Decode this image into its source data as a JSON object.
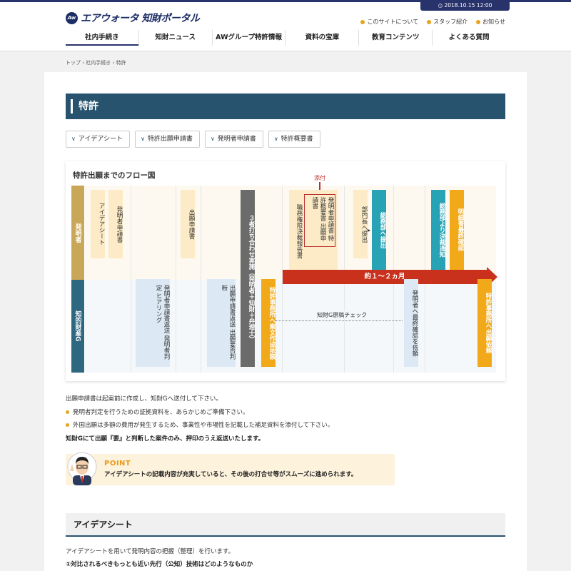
{
  "header": {
    "datetime": "2018.10.15 12:00",
    "logo_mark": "Aw",
    "logo_text": "エアウォータ 知財ポータル",
    "util_links": [
      "このサイトについて",
      "スタッフ紹介",
      "お知らせ"
    ],
    "nav": [
      "社内手続き",
      "知財ニュース",
      "AWグループ特許情報",
      "資料の宝庫",
      "教育コンテンツ",
      "よくある質問"
    ]
  },
  "breadcrumb": "トップ › 社内手続き › 特許",
  "page_title": "特許",
  "tabs": [
    "アイデアシート",
    "特許出願申請書",
    "発明者申請書",
    "特許概要書"
  ],
  "flow": {
    "title": "特許出願までのフロー図",
    "lane_inventor": "発明者",
    "lane_ip": "知的財産G",
    "c_idea": "アイデアシート",
    "c_inventor_app": "発明者申請書",
    "c_app_request": "出願申請書",
    "c_meeting": "３者打ち合わせ実施（発明者＋知財＋弁理士）",
    "attach_label": "添付",
    "c_attach": "発明者申請書 特許概要書 出願申請書",
    "c_report": "職務権限決裁報告書",
    "c_submit_head": "部門長へ提出",
    "c_submit_gen": "総務部へ提出",
    "c_approval": "総務部より決裁通知",
    "c_final_check_spec": "明細書最終確認",
    "duration": "約１〜２ヵ月",
    "c_hearing": "発明者申請書返送 発明者判定 ヒアリング",
    "c_judge": "出願申請書返送 出願要否判断",
    "c_patent_office_draft": "特許事務所へ案文作成依頼",
    "draft_check": "知財G原稿チェック",
    "c_final_confirm": "発明者へ最終確認を依頼",
    "c_filing_request": "特許事務所へ出願依頼"
  },
  "text": {
    "p1": "出願申請書は起案前に作成し、知財Gへ送付して下さい。",
    "li1": "発明者判定を行うための証拠資料を、あらかじめご準備下さい。",
    "li2": "外国出願は多額の費用が発生するため、事業性や市場性を記載した補足資料を添付して下さい。",
    "bold": "知財Gにて出願『要』と判断した案件のみ、押印のうえ返送いたします。",
    "point_title": "POINT",
    "point_text": "アイデアシートの記載内容が充実していると、その後の打合せ等がスムーズに進められます。",
    "h2": "アイデアシート",
    "p2": "アイデアシートを用いて発明内容の把握（整理）を行います。",
    "p3": "①対比されるべきもっとも近い先行（公知）技術はどのようなものか"
  }
}
